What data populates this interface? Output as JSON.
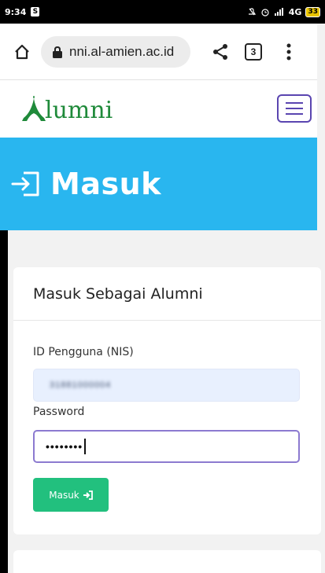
{
  "status": {
    "time": "9:34",
    "notification_icon": "S",
    "network": "4G",
    "battery": "33"
  },
  "browser": {
    "url": "nni.al-amien.ac.id",
    "tab_count": "3"
  },
  "site": {
    "logo_text": "lumni",
    "hero_title": "Masuk"
  },
  "login": {
    "card_title": "Masuk Sebagai Alumni",
    "nis_label": "ID Pengguna (NIS)",
    "nis_value": "31881000004",
    "password_label": "Password",
    "password_value": "••••••••",
    "submit_label": "Masuk"
  },
  "colors": {
    "hero": "#29b6ef",
    "button": "#22c07e",
    "logo": "#1f8a3a",
    "menu": "#5a45b0"
  }
}
